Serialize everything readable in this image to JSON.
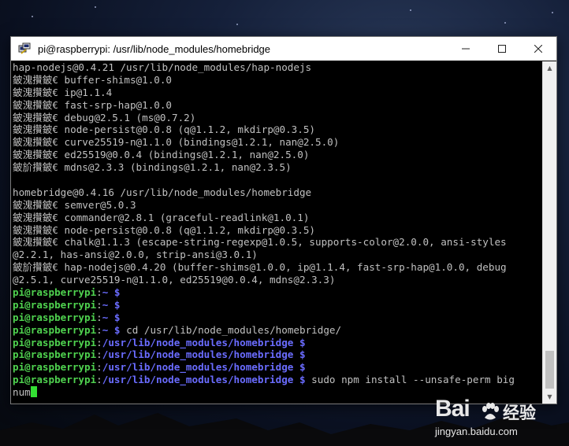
{
  "window": {
    "title": "pi@raspberrypi: /usr/lib/node_modules/homebridge",
    "icon": "putty-icon",
    "controls": [
      "minimize-icon",
      "maximize-icon",
      "close-icon"
    ]
  },
  "terminal": {
    "output": [
      "hap-nodejs@0.4.21 /usr/lib/node_modules/hap-nodejs",
      "鈹溾攢鈹€ buffer-shims@1.0.0",
      "鈹溾攢鈹€ ip@1.1.4",
      "鈹溾攢鈹€ fast-srp-hap@1.0.0",
      "鈹溾攢鈹€ debug@2.5.1 (ms@0.7.2)",
      "鈹溾攢鈹€ node-persist@0.0.8 (q@1.1.2, mkdirp@0.3.5)",
      "鈹溾攢鈹€ curve25519-n@1.1.0 (bindings@1.2.1, nan@2.5.0)",
      "鈹溾攢鈹€ ed25519@0.0.4 (bindings@1.2.1, nan@2.5.0)",
      "鈹斺攢鈹€ mdns@2.3.3 (bindings@1.2.1, nan@2.3.5)",
      "",
      "homebridge@0.4.16 /usr/lib/node_modules/homebridge",
      "鈹溾攢鈹€ semver@5.0.3",
      "鈹溾攢鈹€ commander@2.8.1 (graceful-readlink@1.0.1)",
      "鈹溾攢鈹€ node-persist@0.0.8 (q@1.1.2, mkdirp@0.3.5)",
      "鈹溾攢鈹€ chalk@1.1.3 (escape-string-regexp@1.0.5, supports-color@2.0.0, ansi-styles",
      "@2.2.1, has-ansi@2.0.0, strip-ansi@3.0.1)",
      "鈹斺攢鈹€ hap-nodejs@0.4.20 (buffer-shims@1.0.0, ip@1.1.4, fast-srp-hap@1.0.0, debug",
      "@2.5.1, curve25519-n@1.1.0, ed25519@0.0.4, mdns@2.3.3)"
    ],
    "prompts": [
      {
        "user": "pi@raspberrypi",
        "path": "~",
        "cmd": ""
      },
      {
        "user": "pi@raspberrypi",
        "path": "~",
        "cmd": ""
      },
      {
        "user": "pi@raspberrypi",
        "path": "~",
        "cmd": ""
      },
      {
        "user": "pi@raspberrypi",
        "path": "~",
        "cmd": "cd /usr/lib/node_modules/homebridge/"
      },
      {
        "user": "pi@raspberrypi",
        "path": "/usr/lib/node_modules/homebridge",
        "cmd": ""
      },
      {
        "user": "pi@raspberrypi",
        "path": "/usr/lib/node_modules/homebridge",
        "cmd": ""
      },
      {
        "user": "pi@raspberrypi",
        "path": "/usr/lib/node_modules/homebridge",
        "cmd": ""
      },
      {
        "user": "pi@raspberrypi",
        "path": "/usr/lib/node_modules/homebridge",
        "cmd": "sudo npm install --unsafe-perm big"
      }
    ],
    "current_input_wrap": "num",
    "colors": {
      "user": "#4fd24f",
      "path": "#6a6cff",
      "text": "#c0c0c0",
      "cursor": "#34e034"
    }
  },
  "watermark": {
    "brand": "Bai",
    "brand_cn": "经验",
    "url": "jingyan.baidu.com"
  }
}
